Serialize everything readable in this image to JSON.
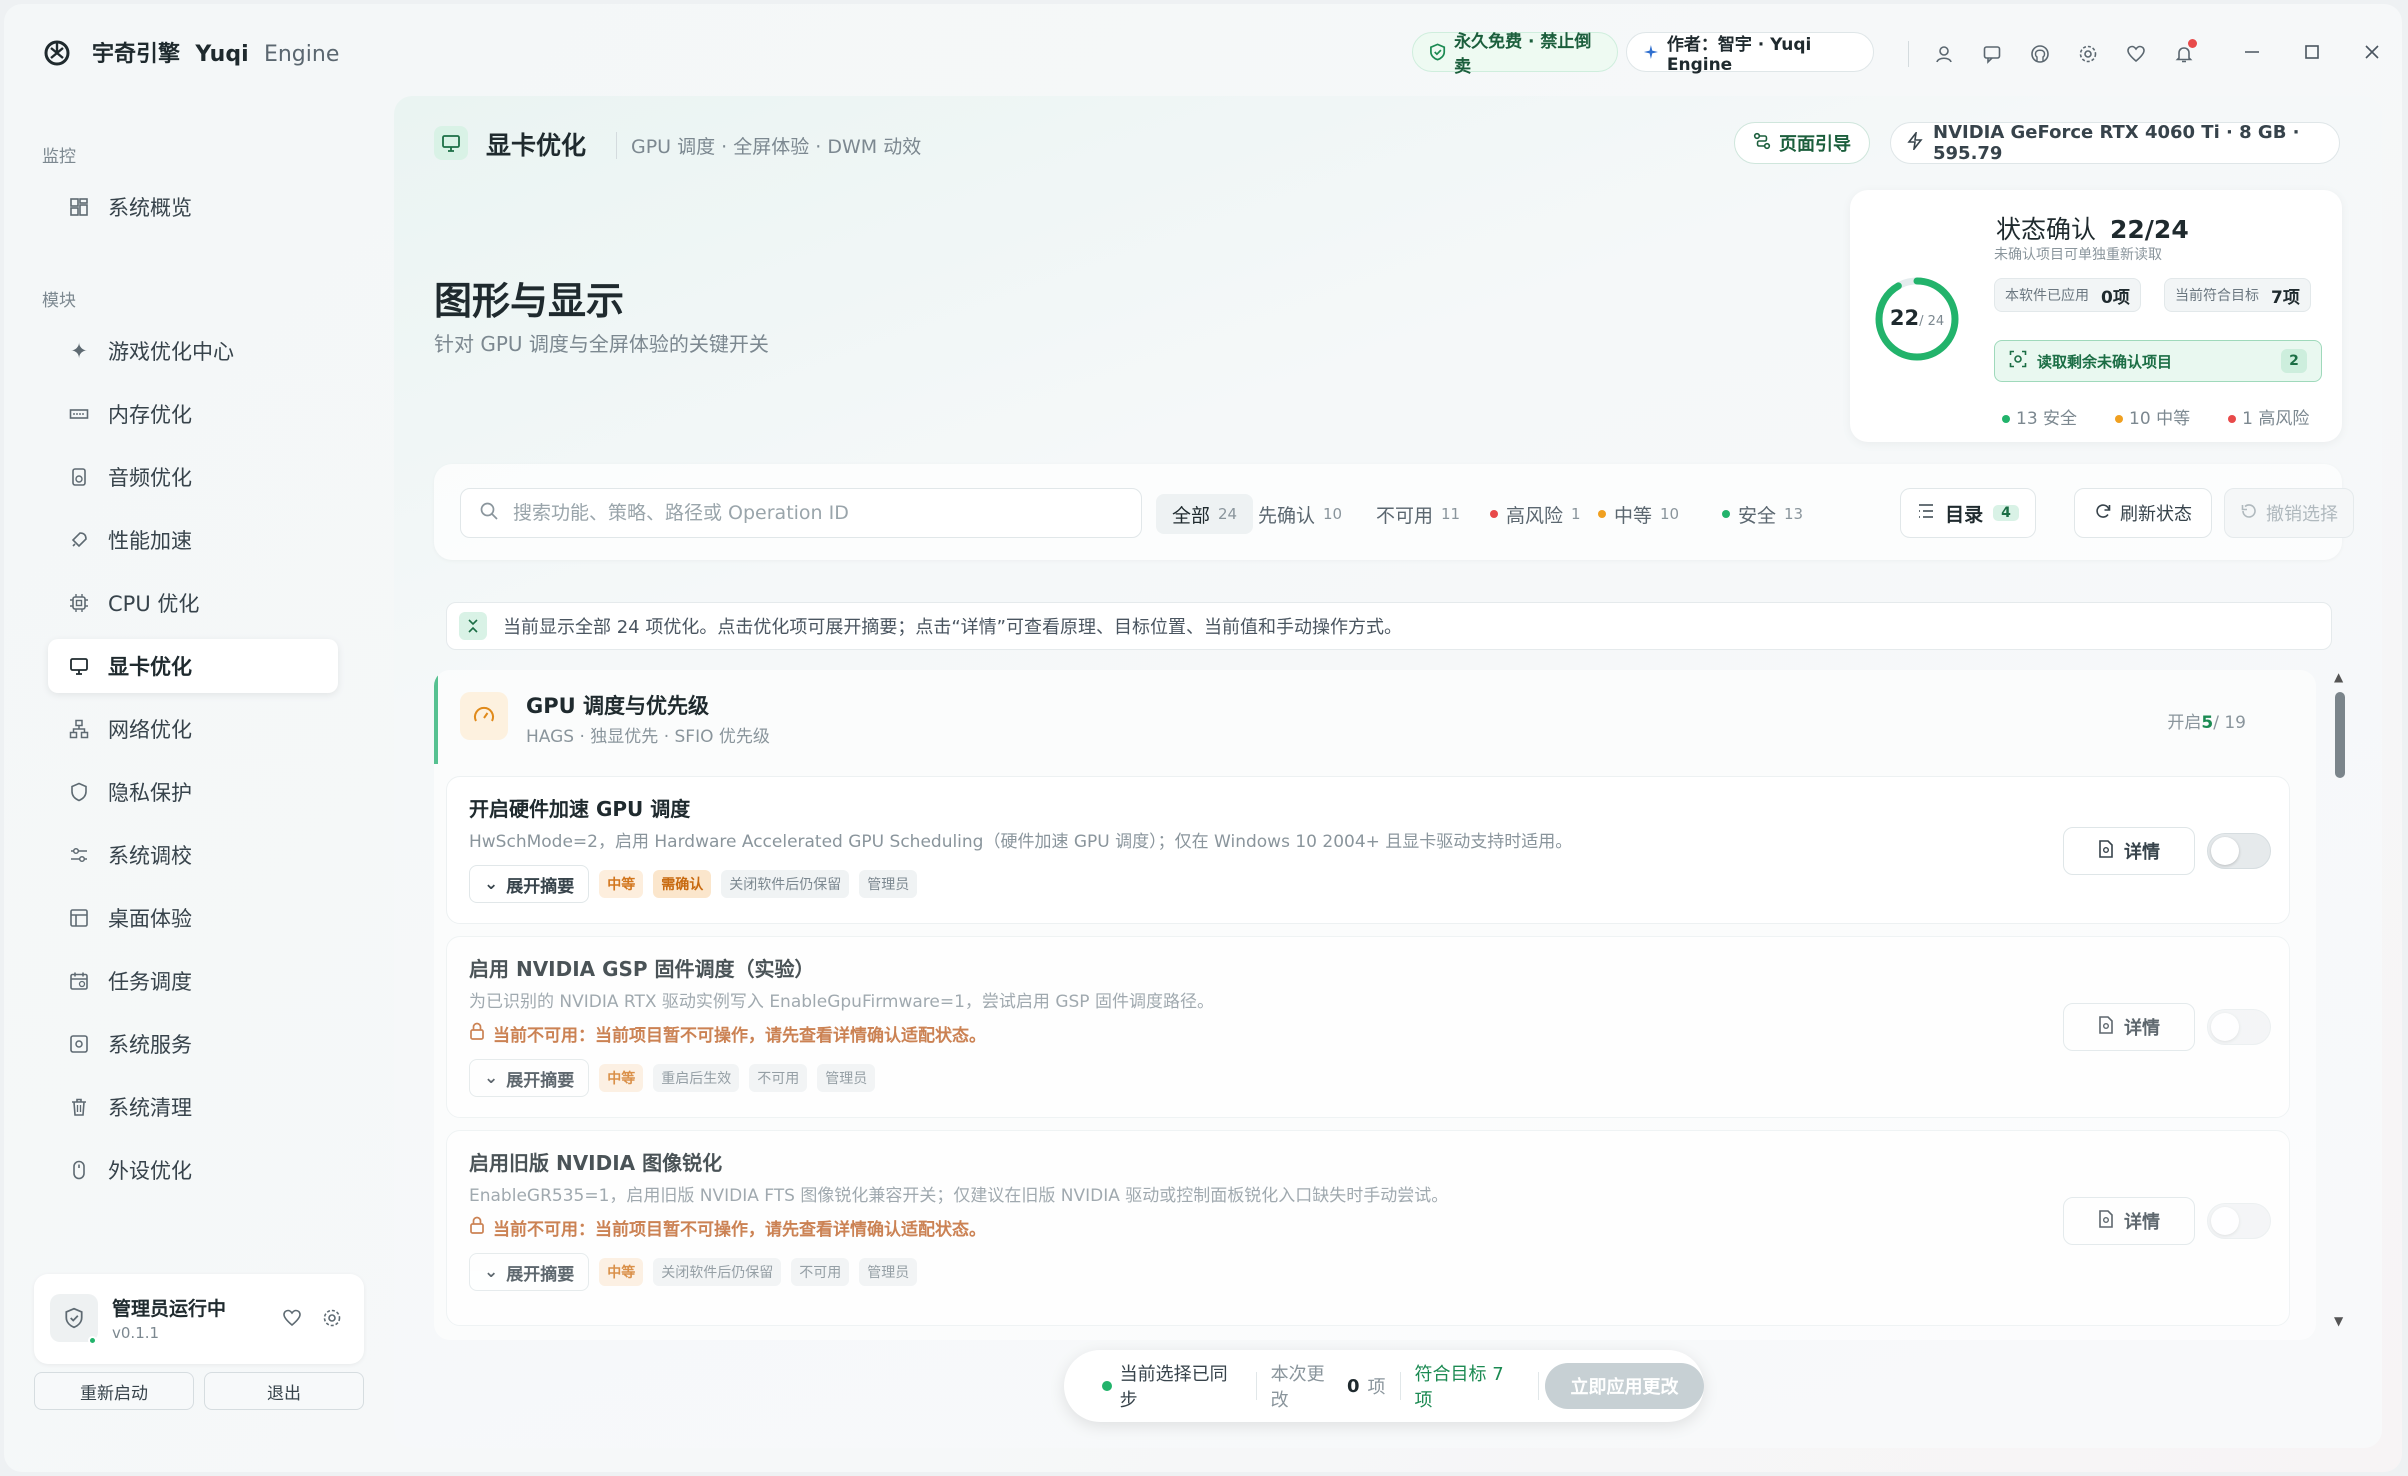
{
  "app": {
    "name_cn": "宇奇引擎",
    "name_en1": "Yuqi",
    "name_en2": "Engine",
    "badge_free": "永久免费 · 禁止倒卖",
    "badge_author": "作者：智宇 · Yuqi Engine"
  },
  "sidebar": {
    "group_monitor": "监控",
    "group_modules": "模块",
    "overview": "系统概览",
    "items": [
      {
        "label": "游戏优化中心",
        "icon": "rocket-star-icon"
      },
      {
        "label": "内存优化",
        "icon": "memory-icon"
      },
      {
        "label": "音频优化",
        "icon": "speaker-icon"
      },
      {
        "label": "性能加速",
        "icon": "rocket-icon"
      },
      {
        "label": "CPU 优化",
        "icon": "cpu-icon"
      },
      {
        "label": "显卡优化",
        "icon": "monitor-icon"
      },
      {
        "label": "网络优化",
        "icon": "network-icon"
      },
      {
        "label": "隐私保护",
        "icon": "shield-icon"
      },
      {
        "label": "系统调校",
        "icon": "sliders-icon"
      },
      {
        "label": "桌面体验",
        "icon": "layout-icon"
      },
      {
        "label": "任务调度",
        "icon": "calendar-icon"
      },
      {
        "label": "系统服务",
        "icon": "service-icon"
      },
      {
        "label": "系统清理",
        "icon": "trash-icon"
      },
      {
        "label": "外设优化",
        "icon": "mouse-icon"
      }
    ],
    "admin_title": "管理员运行中",
    "admin_version": "v0.1.1",
    "restart": "重新启动",
    "exit": "退出"
  },
  "header": {
    "title": "显卡优化",
    "subtitle": "GPU 调度 · 全屏体验 · DWM 动效",
    "guide": "页面引导",
    "gpu": "NVIDIA GeForce RTX 4060 Ti · 8 GB · 595.79"
  },
  "section": {
    "title": "图形与显示",
    "desc": "针对 GPU 调度与全屏体验的关键开关"
  },
  "status": {
    "title": "状态确认",
    "value": "22/24",
    "ring_num": "22",
    "ring_den": "/ 24",
    "ring_fraction": 0.9167,
    "note": "未确认项目可单独重新读取",
    "applied_label": "本软件已应用",
    "applied_value": "0项",
    "match_label": "当前符合目标",
    "match_value": "7项",
    "read_btn": "读取剩余未确认项目",
    "read_count": "2",
    "safe": "13 安全",
    "medium": "10 中等",
    "high": "1 高风险",
    "colors": {
      "safe": "#22b36b",
      "medium": "#f0a020",
      "high": "#e84a4a"
    }
  },
  "filter": {
    "search_placeholder": "搜索功能、策略、路径或 Operation ID",
    "all": "全部",
    "all_n": "24",
    "pending": "先确认",
    "pending_n": "10",
    "unavailable": "不可用",
    "unavailable_n": "11",
    "high": "高风险",
    "high_n": "1",
    "medium": "中等",
    "medium_n": "10",
    "safe": "安全",
    "safe_n": "13",
    "toc": "目录",
    "toc_n": "4",
    "refresh": "刷新状态",
    "undo": "撤销选择"
  },
  "info": "当前显示全部 24 项优化。点击优化项可展开摘要；点击“详情”可查看原理、目标位置、当前值和手动操作方式。",
  "group": {
    "title": "GPU 调度与优先级",
    "sub": "HAGS · 独显优先 · SFIO 优先级",
    "count_prefix": "开启",
    "count_on": "5",
    "count_total": "/ 19"
  },
  "cards": [
    {
      "title": "开启硬件加速 GPU 调度",
      "desc": "HwSchMode=2，启用 Hardware Accelerated GPU Scheduling（硬件加速 GPU 调度）；仅在 Windows 10 2004+ 且显卡驱动支持时适用。",
      "expand": "展开摘要",
      "tags": [
        "中等",
        "需确认",
        "关闭软件后仍保留",
        "管理员"
      ],
      "detail": "详情"
    },
    {
      "title": "启用 NVIDIA GSP 固件调度（实验）",
      "desc": "为已识别的 NVIDIA RTX 驱动实例写入 EnableGpuFirmware=1，尝试启用 GSP 固件调度路径。",
      "warn": "当前不可用：当前项目暂不可操作，请先查看详情确认适配状态。",
      "expand": "展开摘要",
      "tags": [
        "中等",
        "重启后生效",
        "不可用",
        "管理员"
      ],
      "detail": "详情"
    },
    {
      "title": "启用旧版 NVIDIA 图像锐化",
      "desc": "EnableGR535=1，启用旧版 NVIDIA FTS 图像锐化兼容开关；仅建议在旧版 NVIDIA 驱动或控制面板锐化入口缺失时手动尝试。",
      "warn": "当前不可用：当前项目暂不可操作，请先查看详情确认适配状态。",
      "expand": "展开摘要",
      "tags": [
        "中等",
        "关闭软件后仍保留",
        "不可用",
        "管理员"
      ],
      "detail": "详情"
    }
  ],
  "bottom": {
    "synced": "当前选择已同步",
    "changes_label": "本次更改",
    "changes_n": "0",
    "changes_unit": "项",
    "match": "符合目标 7 项",
    "apply": "立即应用更改"
  }
}
